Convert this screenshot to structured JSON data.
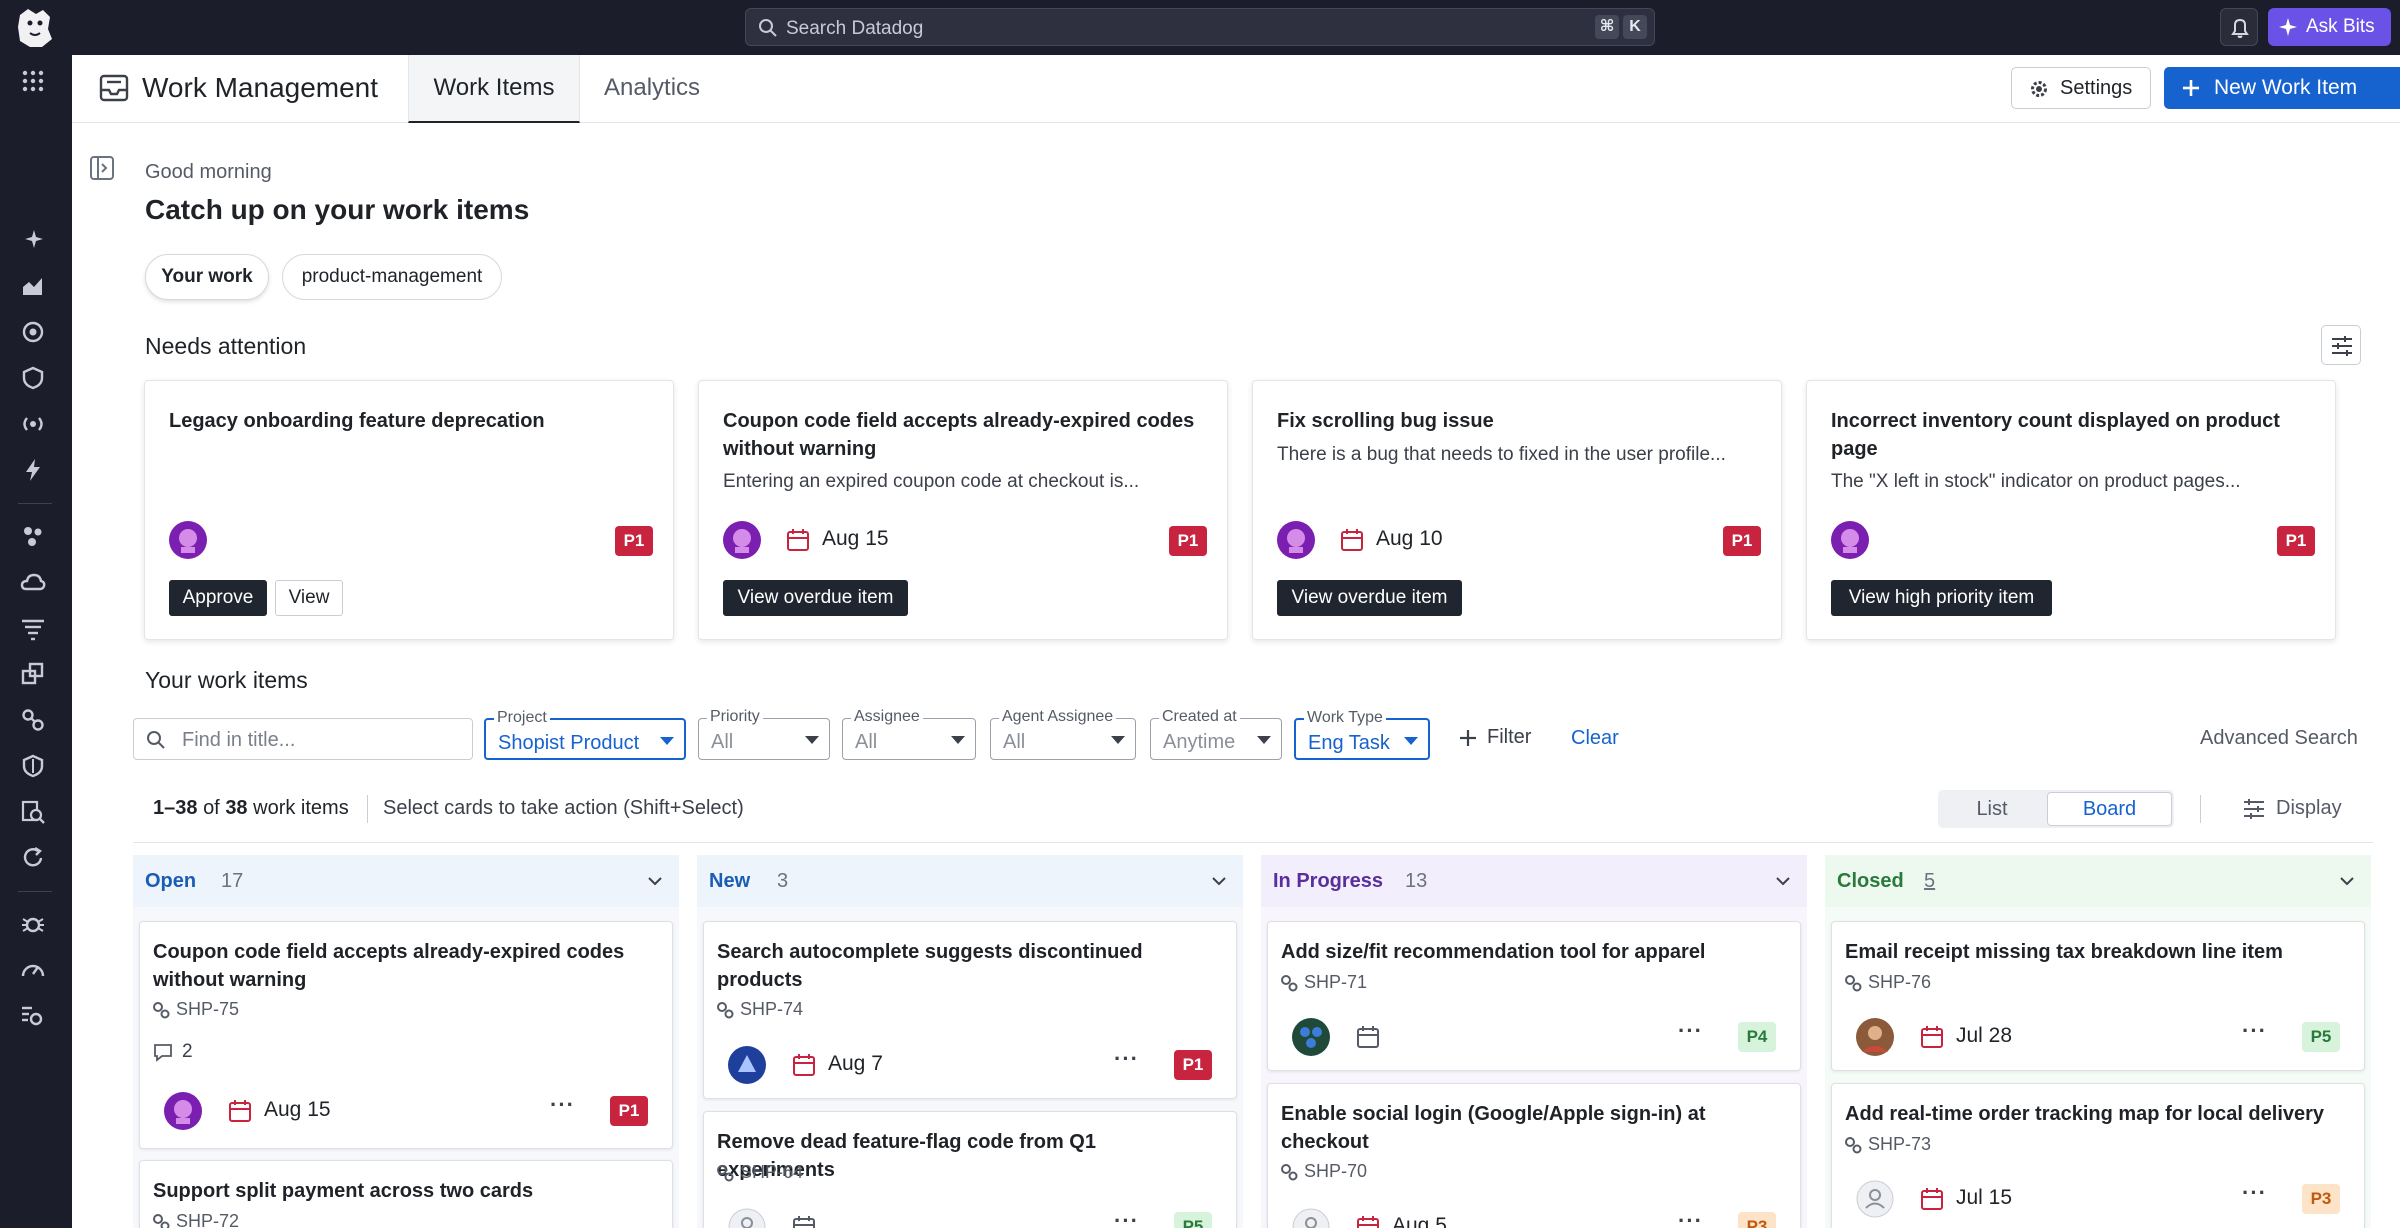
{
  "topbar": {
    "search_placeholder": "Search Datadog",
    "shortcut_mod": "⌘",
    "shortcut_key": "K",
    "ask_bits_label": "Ask Bits"
  },
  "header": {
    "title": "Work Management",
    "tabs": [
      {
        "label": "Work Items",
        "active": true
      },
      {
        "label": "Analytics",
        "active": false
      }
    ],
    "settings_label": "Settings",
    "new_item_label": "New Work Item"
  },
  "greeting": "Good morning",
  "heading": "Catch up on your work items",
  "chips": [
    {
      "label": "Your work",
      "active": true
    },
    {
      "label": "product-management",
      "active": false
    }
  ],
  "needs_attention": {
    "title": "Needs attention",
    "cards": [
      {
        "title": "Legacy onboarding feature deprecation",
        "description": "",
        "date": "",
        "priority": "P1",
        "actions": [
          "Approve",
          "View"
        ]
      },
      {
        "title": "Coupon code field accepts already-expired codes without warning",
        "description": "Entering an expired coupon code at checkout is...",
        "date": "Aug 15",
        "priority": "P1",
        "actions": [
          "View overdue item"
        ]
      },
      {
        "title": "Fix scrolling bug issue",
        "description": "There is a bug that needs to fixed in the user profile...",
        "date": "Aug 10",
        "priority": "P1",
        "actions": [
          "View overdue item"
        ]
      },
      {
        "title": "Incorrect inventory count displayed on product page",
        "description": "The \"X left in stock\" indicator on product pages...",
        "date": "",
        "priority": "P1",
        "actions": [
          "View high priority item"
        ]
      }
    ]
  },
  "your_work_items": {
    "title": "Your work items",
    "find_placeholder": "Find in title...",
    "filters": [
      {
        "label": "Project",
        "value": "Shopist Product",
        "active": true
      },
      {
        "label": "Priority",
        "value": "All",
        "active": false
      },
      {
        "label": "Assignee",
        "value": "All",
        "active": false
      },
      {
        "label": "Agent Assignee",
        "value": "All",
        "active": false
      },
      {
        "label": "Created at",
        "value": "Anytime",
        "active": false
      },
      {
        "label": "Work Type",
        "value": "Eng Task",
        "active": true
      }
    ],
    "filter_label": "Filter",
    "clear_label": "Clear",
    "advanced_search_label": "Advanced Search",
    "count_range": "1–38",
    "count_of": "of",
    "count_total": "38",
    "count_suffix": "work items",
    "select_hint": "Select cards to take action (Shift+Select)",
    "view_list_label": "List",
    "view_board_label": "Board",
    "display_label": "Display"
  },
  "board": {
    "columns": [
      {
        "name": "Open",
        "count": "17",
        "color": "#1b5cb5",
        "bg": "#eef4fb",
        "cards": [
          {
            "title": "Coupon code field accepts already-expired codes without warning",
            "id": "SHP-75",
            "comments": "2",
            "date": "Aug 15",
            "priority": "P1"
          },
          {
            "title": "Support split payment across two cards",
            "id": "SHP-72",
            "comments": "",
            "date": "",
            "priority": ""
          }
        ]
      },
      {
        "name": "New",
        "count": "3",
        "color": "#1b5cb5",
        "bg": "#eef4fb",
        "cards": [
          {
            "title": "Search autocomplete suggests discontinued products",
            "id": "SHP-74",
            "comments": "",
            "date": "Aug 7",
            "priority": "P1"
          },
          {
            "title": "Remove dead feature-flag code from Q1 experiments",
            "id": "SHP-64",
            "comments": "",
            "date": "",
            "priority": "P5"
          }
        ]
      },
      {
        "name": "In Progress",
        "count": "13",
        "color": "#5a2f9c",
        "bg": "#f2eefb",
        "cards": [
          {
            "title": "Add size/fit recommendation tool for apparel",
            "id": "SHP-71",
            "comments": "",
            "date": "",
            "priority": "P4"
          },
          {
            "title": "Enable social login (Google/Apple sign-in) at checkout",
            "id": "SHP-70",
            "comments": "",
            "date": "Aug 5",
            "priority": "P3"
          }
        ]
      },
      {
        "name": "Closed",
        "count": "5",
        "color": "#2a7a3b",
        "bg": "#edf8ef",
        "cards": [
          {
            "title": "Email receipt missing tax breakdown line item",
            "id": "SHP-76",
            "comments": "",
            "date": "Jul 28",
            "priority": "P5"
          },
          {
            "title": "Add real-time order tracking map for local delivery",
            "id": "SHP-73",
            "comments": "",
            "date": "Jul 15",
            "priority": "P3"
          }
        ]
      }
    ]
  },
  "colors": {
    "accent": "#1663d0",
    "nav_bg": "#1c1d2b",
    "ask_bits": "#6b52e6",
    "p1": "#c9243f"
  }
}
